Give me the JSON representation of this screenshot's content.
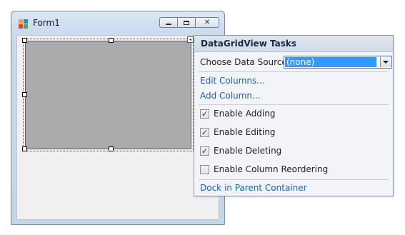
{
  "form": {
    "title": "Form1",
    "icons": {
      "app": "form-app-icon",
      "minimize": "minimize-icon",
      "maximize": "maximize-icon",
      "close": "close-icon"
    },
    "close_glyph": "✕"
  },
  "grid": {
    "smart_tag_glyph": "◂"
  },
  "tasks_panel": {
    "title": "DataGridView Tasks",
    "data_source_label": "Choose Data Source:",
    "data_source_value": "(none)",
    "links": {
      "edit_columns": "Edit Columns...",
      "add_column": "Add Column...",
      "dock": "Dock in Parent Container"
    },
    "options": [
      {
        "label": "Enable Adding",
        "checked": true
      },
      {
        "label": "Enable Editing",
        "checked": true
      },
      {
        "label": "Enable Deleting",
        "checked": true
      },
      {
        "label": "Enable Column Reordering",
        "checked": false
      }
    ],
    "check_glyph": "✓"
  },
  "colors": {
    "accent_selection": "#3399ff",
    "link": "#1d5fae",
    "grid_background": "#ababab"
  }
}
